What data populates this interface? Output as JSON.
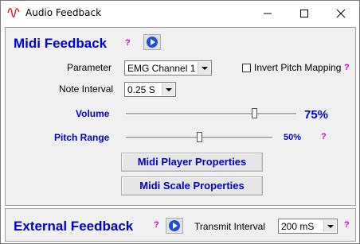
{
  "window": {
    "title": "Audio Feedback",
    "icon": "waveform-icon",
    "controls": [
      "minimize-icon",
      "maximize-icon",
      "close-icon"
    ]
  },
  "midi": {
    "heading": "Midi Feedback",
    "help": "?",
    "parameter_label": "Parameter",
    "parameter_value": "EMG Channel 1",
    "invert_label": "Invert Pitch Mapping",
    "invert_checked": false,
    "invert_help": "?",
    "note_interval_label": "Note Interval",
    "note_interval_value": "0.25 S",
    "volume_label": "Volume",
    "volume_value": "75%",
    "volume_level": 0.75,
    "pitch_label": "Pitch Range",
    "pitch_value": "50%",
    "pitch_level": 0.5,
    "pitch_help": "?",
    "player_button": "Midi Player Properties",
    "scale_button": "Midi Scale Properties"
  },
  "external": {
    "heading": "External Feedback",
    "help": "?",
    "transmit_label": "Transmit Interval",
    "transmit_value": "200 mS",
    "transmit_help": "?"
  },
  "colors": {
    "accent_blue": "#0000cc",
    "help_magenta": "#cc00cc",
    "play_blue": "#1e4fd6",
    "panel_bg": "#f0f0f0"
  }
}
